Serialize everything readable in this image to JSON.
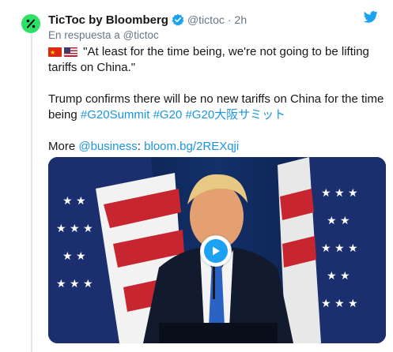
{
  "tweet": {
    "author_name": "TicToc by Bloomberg",
    "handle": "@tictoc",
    "separator": "·",
    "time": "2h",
    "reply_prefix": "En respuesta a",
    "reply_handle": "@tictoc",
    "quote": "\"At least for the time being, we're not going to be lifting tariffs on China.\"",
    "body_intro": "Trump confirms there will be no new tariffs on China for the time being",
    "hashtags": [
      "#G20Summit",
      "#G20",
      "#G20大阪サミット"
    ],
    "more_label": "More",
    "more_mention": "@business",
    "more_colon": ":",
    "more_link": "bloom.bg/2REXqji"
  },
  "icons": {
    "avatar": "tictoc-logo-icon",
    "verified": "verified-badge-icon",
    "platform": "twitter-bird-icon",
    "flag_1": "china-flag-icon",
    "flag_2": "us-flag-icon",
    "play": "play-icon"
  },
  "colors": {
    "link": "#1b95e0",
    "accent": "#1da1f2",
    "avatar_bg": "#2de066",
    "muted": "#657786"
  }
}
